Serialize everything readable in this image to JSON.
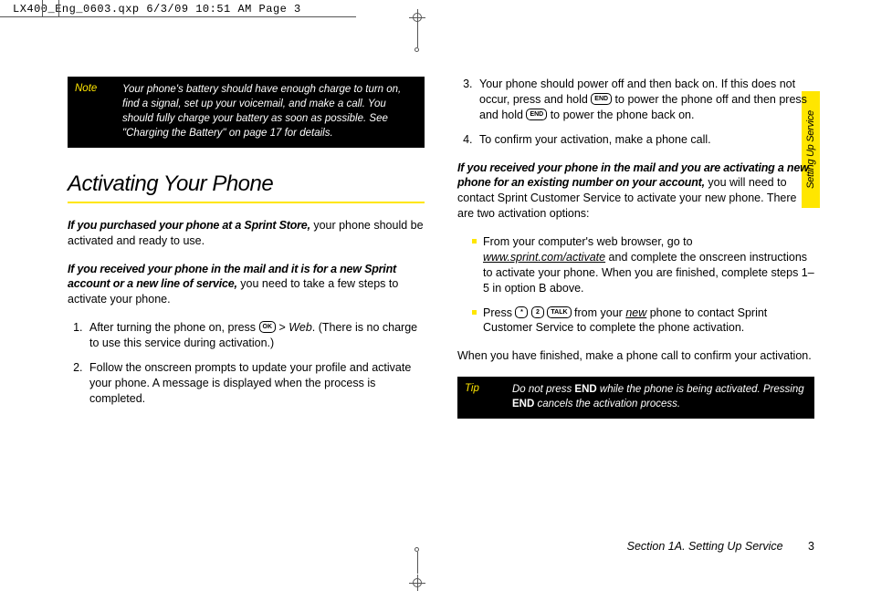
{
  "header_qxp": "LX400_Eng_0603.qxp  6/3/09  10:51 AM  Page 3",
  "note": {
    "label": "Note",
    "text": "Your phone's battery should have enough charge to turn on, find a signal, set up your voicemail, and make a call. You should fully charge your battery as soon as possible. See \"Charging the Battery\" on page 17 for details."
  },
  "heading": "Activating Your Phone",
  "left": {
    "p1_lead": "If you purchased your phone at a Sprint Store,",
    "p1_rest": " your phone should be activated and ready to use.",
    "p2_lead": "If you received your phone in the mail and it is for a new Sprint account or a new line of service,",
    "p2_rest": " you need to take a few steps to activate your phone.",
    "step1_a": "After turning the phone on, press ",
    "step1_key": "OK",
    "step1_b": " > ",
    "step1_web": "Web",
    "step1_c": ". (There is no charge to use this service during activation.)",
    "step2": "Follow the onscreen prompts to update your profile and activate your phone. A message is displayed when the process is completed."
  },
  "right": {
    "step3_a": "Your phone should power off and then back on. If this does not occur, press and hold ",
    "step3_k1": "END",
    "step3_b": " to power the phone off and then press and hold ",
    "step3_k2": "END",
    "step3_c": " to power the phone back on.",
    "step4": "To confirm your activation, make a phone call.",
    "p3_lead": "If you received your phone in the mail and you are activating a new phone for an existing number on your account,",
    "p3_rest": " you will need to contact Sprint Customer Service to activate your new phone. There are two activation options:",
    "b1_a": "From your computer's web browser, go to ",
    "b1_link": "www.sprint.com/activate",
    "b1_b": " and complete the onscreen instructions to activate your phone. When you are finished, complete steps 1–5 in option B above.",
    "b2_a": "Press ",
    "b2_k1": "*",
    "b2_k2": "2",
    "b2_k3": "TALK",
    "b2_b": " from your ",
    "b2_new": "new",
    "b2_c": " phone to contact Sprint Customer Service to complete the phone activation.",
    "p4": "When you have finished, make a phone call to confirm your activation."
  },
  "tip": {
    "label": "Tip",
    "a": "Do not press ",
    "end": "END",
    "b": " while the phone is being activated. Pressing ",
    "c": " cancels the activation process."
  },
  "footer": {
    "section": "Section 1A. Setting Up Service",
    "page": "3"
  },
  "sidetab": "Setting Up Service"
}
